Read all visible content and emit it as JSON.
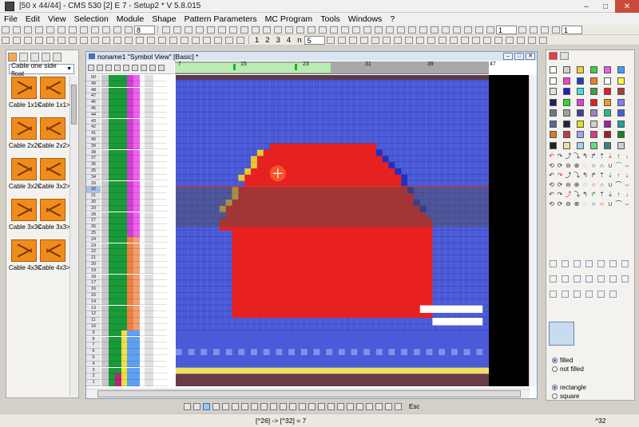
{
  "window": {
    "title": "[50 x 44/44] - CMS 530 [2] E 7 - Setup2 *   V 5.8.015",
    "minimize": "–",
    "maximize": "□",
    "close": "✕"
  },
  "menu": [
    "File",
    "Edit",
    "View",
    "Selection",
    "Module",
    "Shape",
    "Pattern Parameters",
    "MC Program",
    "Tools",
    "Windows",
    "?"
  ],
  "toolbar": {
    "zoom": "8",
    "field1": "1",
    "field2": "1",
    "numbers": [
      "1",
      "2",
      "3",
      "4",
      "n"
    ],
    "field3": "5"
  },
  "left_panel": {
    "category": "Cable one side float",
    "items": [
      {
        "label": "Cable 1x1<"
      },
      {
        "label": "Cable 1x1>"
      },
      {
        "label": "Cable 2x2<"
      },
      {
        "label": "Cable 2x2>"
      },
      {
        "label": "Cable 3x2<"
      },
      {
        "label": "Cable 3x2>"
      },
      {
        "label": "Cable 3x3<"
      },
      {
        "label": "Cable 3x3>"
      },
      {
        "label": "Cable 4x3<"
      },
      {
        "label": "Cable 4x3>"
      }
    ]
  },
  "document": {
    "title": "noname1 \"Symbol View\" [Basic] *",
    "ruler_ticks": [
      "7",
      "15",
      "23",
      "31",
      "39",
      "47"
    ],
    "row_labels": [
      "50",
      "49",
      "48",
      "47",
      "46",
      "45",
      "44",
      "43",
      "42",
      "41",
      "40",
      "39",
      "38",
      "37",
      "36",
      "35",
      "34",
      "33",
      "32",
      "31",
      "30",
      "29",
      "28",
      "27",
      "26",
      "25",
      "24",
      "23",
      "22",
      "21",
      "20",
      "19",
      "18",
      "17",
      "16",
      "15",
      "14",
      "13",
      "12",
      "11",
      "10",
      "9",
      "8",
      "7",
      "6",
      "5",
      "4",
      "3",
      "2",
      "1"
    ]
  },
  "right_panel": {
    "option_filled": "filled",
    "option_not_filled": "not filled",
    "option_rectangle": "rectangle",
    "option_square": "square",
    "colors": [
      "#ffffff",
      "#d0d0d0",
      "#f0d040",
      "#40d040",
      "#e060e0",
      "#40a0ff",
      "#ffffff",
      "#ff40c0",
      "#2040c0",
      "#f08020",
      "#ffffff",
      "#ffff40",
      "#e0e0e0",
      "#2020c0",
      "#40e0e0",
      "#40a040",
      "#e02020",
      "#a04040",
      "#202060",
      "#20e020",
      "#e040e0",
      "#e02020",
      "#e0a020",
      "#8080ff",
      "#608080",
      "#a0a0a0",
      "#4040a0",
      "#a080c0",
      "#20c080",
      "#4060e0",
      "#6060a0",
      "#202040",
      "#e0e020",
      "#d0d0d0",
      "#a020a0",
      "#20a0a0",
      "#d08020",
      "#c04040",
      "#a0a0ff",
      "#d04080",
      "#a02020",
      "#208020",
      "#202020",
      "#f0e0a0",
      "#a0d0ff",
      "#60e080",
      "#408080",
      "#d0d0d0"
    ]
  },
  "status": {
    "coordinates": "[^26] -> [^32] = 7",
    "right": "^32"
  }
}
